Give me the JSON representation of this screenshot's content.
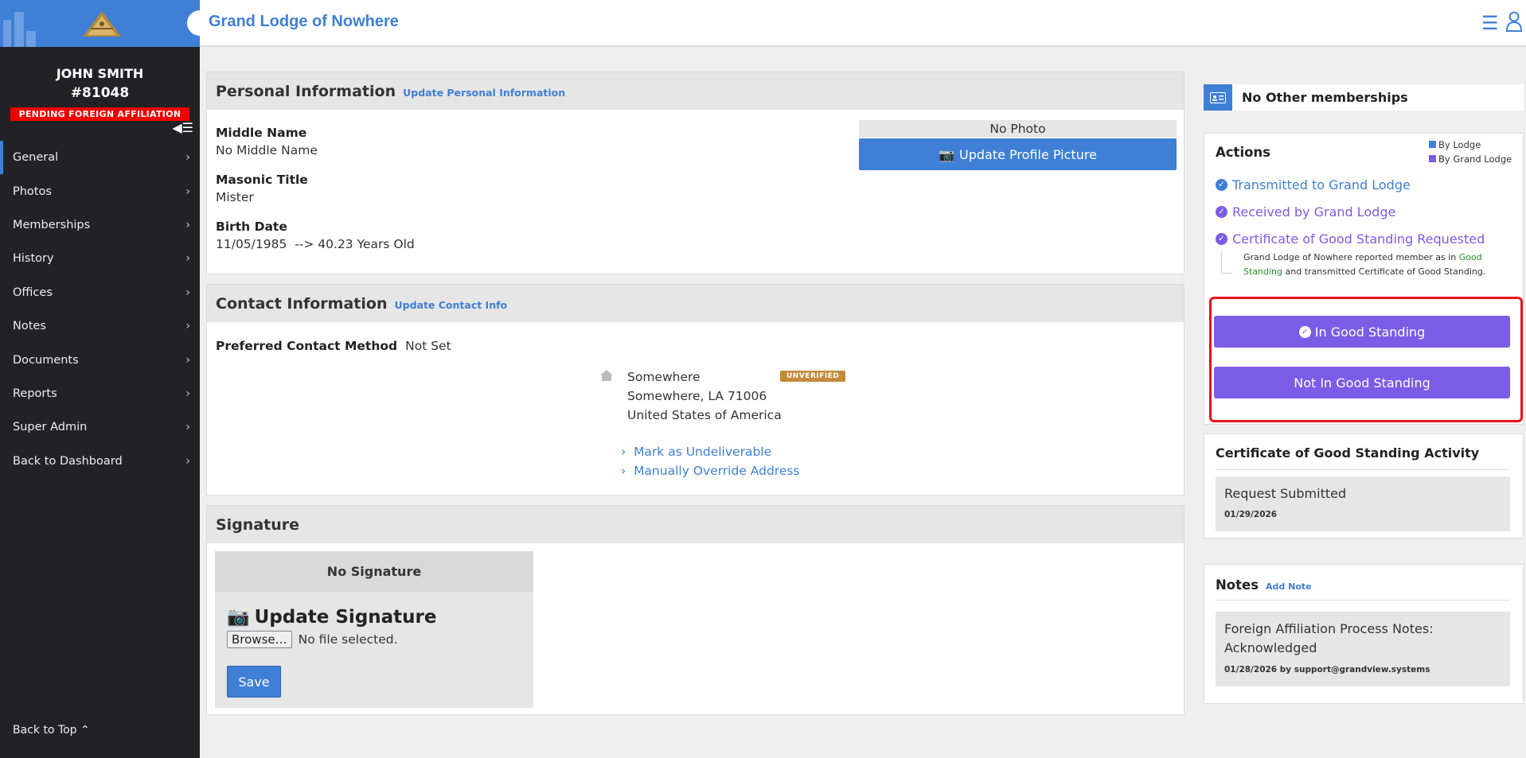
{
  "sidebar": {
    "member_name": "JOHN SMITH",
    "member_number": "#81048",
    "status_badge": "PENDING FOREIGN AFFILIATION",
    "nav": [
      {
        "label": "General"
      },
      {
        "label": "Photos"
      },
      {
        "label": "Memberships"
      },
      {
        "label": "History"
      },
      {
        "label": "Offices"
      },
      {
        "label": "Notes"
      },
      {
        "label": "Documents"
      },
      {
        "label": "Reports"
      },
      {
        "label": "Super Admin"
      },
      {
        "label": "Back to Dashboard"
      }
    ],
    "back_to_top": "Back to Top ⌃"
  },
  "topbar": {
    "title": "Grand Lodge of Nowhere"
  },
  "personal": {
    "heading": "Personal Information",
    "update_link": "Update Personal Information",
    "middle_name_label": "Middle Name",
    "middle_name_value": "No Middle Name",
    "masonic_title_label": "Masonic Title",
    "masonic_title_value": "Mister",
    "birth_date_label": "Birth Date",
    "birth_date_value": "11/05/1985  --> 40.23 Years Old",
    "no_photo": "No Photo",
    "update_picture": "Update Profile Picture"
  },
  "contact": {
    "heading": "Contact Information",
    "update_link": "Update Contact Info",
    "preferred_label": "Preferred Contact Method",
    "preferred_value": "Not Set",
    "address_line1": "Somewhere",
    "address_line2": "Somewhere, LA 71006",
    "address_line3": "United States of America",
    "unverified": "UNVERIFIED",
    "mark_undeliverable": "Mark as Undeliverable",
    "override_address": "Manually Override Address"
  },
  "signature": {
    "heading": "Signature",
    "no_signature": "No Signature",
    "update_signature": "Update Signature",
    "browse": "Browse…",
    "no_file": "No file selected.",
    "save": "Save"
  },
  "memberships": {
    "label": "No Other memberships"
  },
  "actions": {
    "heading": "Actions",
    "legend_lodge": "By Lodge",
    "legend_grand_lodge": "By Grand Lodge",
    "items": [
      {
        "label": "Transmitted to Grand Lodge",
        "color": "#3f7fd6"
      },
      {
        "label": "Received by Grand Lodge",
        "color": "#7b5ce6"
      },
      {
        "label": "Certificate of Good Standing Requested",
        "color": "#7b5ce6"
      }
    ],
    "note_part1": "Grand Lodge of Nowhere reported member as in ",
    "note_good": "Good",
    "note_standing": "Standing",
    "note_part2": " and transmitted Certificate of Good Standing.",
    "in_good_standing": "In Good Standing",
    "not_in_good_standing": "Not In Good Standing"
  },
  "cogs_activity": {
    "heading": "Certificate of Good Standing Activity",
    "item_title": "Request Submitted",
    "item_date": "01/29/2026"
  },
  "notes": {
    "heading": "Notes",
    "add_note": "Add Note",
    "item_text": "Foreign Affiliation Process Notes: Acknowledged",
    "item_meta": "01/28/2026 by support@grandview.systems"
  },
  "colors": {
    "primary": "#3f7fd6",
    "purple": "#7b5ce6",
    "badge_red": "#e00",
    "highlight_red": "#e8141c",
    "sidebar": "#222226"
  }
}
